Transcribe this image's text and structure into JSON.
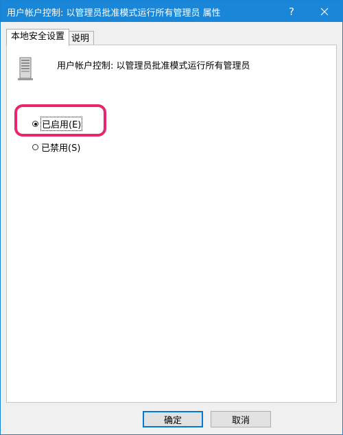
{
  "window": {
    "title": "用户帐户控制: 以管理员批准模式运行所有管理员 属性",
    "help_label": "?",
    "accent_color": "#1a86d8"
  },
  "tabs": [
    {
      "label": "本地安全设置",
      "active": true
    },
    {
      "label": "说明",
      "active": false
    }
  ],
  "policy": {
    "icon": "server-computer-icon",
    "title": "用户帐户控制: 以管理员批准模式运行所有管理员"
  },
  "options": [
    {
      "label": "已启用(E)",
      "checked": true
    },
    {
      "label": "已禁用(S)",
      "checked": false
    }
  ],
  "highlight_color": "#e8256f",
  "buttons": {
    "ok_label": "确定",
    "cancel_label": "取消"
  }
}
